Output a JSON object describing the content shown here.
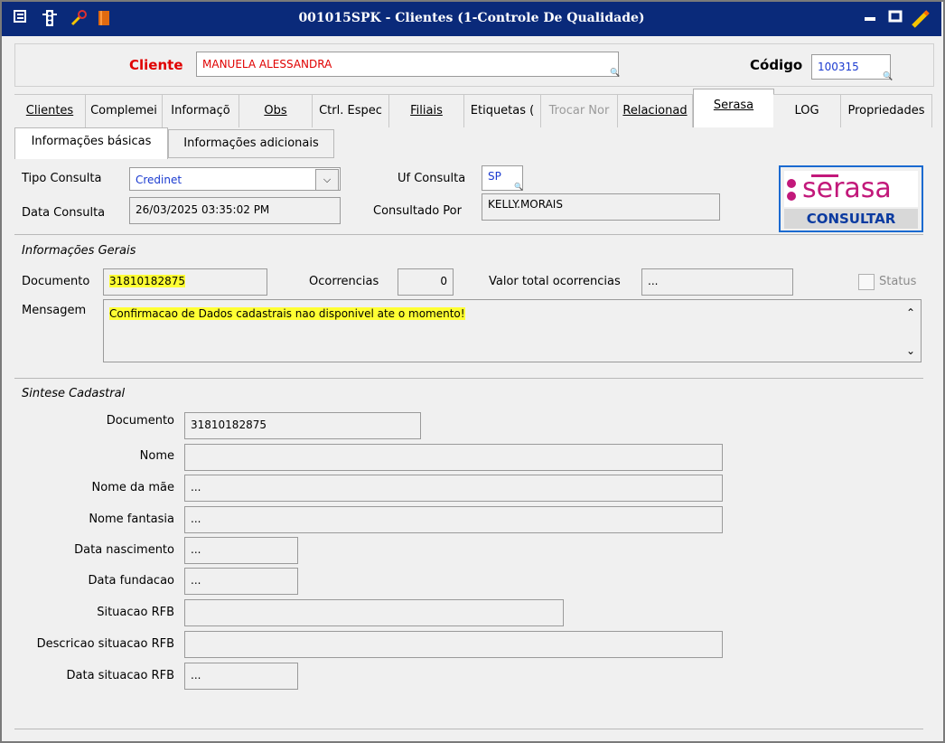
{
  "window": {
    "title": "001015SPK - Clientes (1-Controle De Qualidade)",
    "icons": [
      "menu-icon",
      "traffic-light-icon",
      "wrench-icon",
      "book-icon"
    ],
    "controls": [
      "minimize-icon",
      "maximize-icon",
      "pencil-icon"
    ]
  },
  "header": {
    "cliente_label": "Cliente",
    "cliente_value": "MANUELA ALESSANDRA",
    "codigo_label": "Código",
    "codigo_value": "100315"
  },
  "tabs": [
    {
      "label": "Clientes"
    },
    {
      "label": "Complemei"
    },
    {
      "label": "Informaçõ"
    },
    {
      "label": "Obs"
    },
    {
      "label": "Ctrl. Espec"
    },
    {
      "label": "Filiais"
    },
    {
      "label": "Etiquetas ("
    },
    {
      "label": "Trocar Nor"
    },
    {
      "label": "Relacionad"
    },
    {
      "label": "Serasa"
    },
    {
      "label": "LOG"
    },
    {
      "label": "Propriedades"
    }
  ],
  "subtabs": [
    {
      "label": "Informações básicas"
    },
    {
      "label": "Informações adicionais"
    }
  ],
  "consulta": {
    "tipo_label": "Tipo Consulta",
    "tipo_value": "Credinet",
    "uf_label": "Uf Consulta",
    "uf_value": "SP",
    "data_label": "Data Consulta",
    "data_value": "26/03/2025 03:35:02 PM",
    "consultado_label": "Consultado Por",
    "consultado_value": "KELLY.MORAIS",
    "serasa_logo": "serasa",
    "consultar_label": "CONSULTAR"
  },
  "gerais": {
    "section_label": "Informações Gerais",
    "documento_label": "Documento",
    "documento_value": "31810182875",
    "ocorrencias_label": "Ocorrencias",
    "ocorrencias_value": "0",
    "valor_label": "Valor total ocorrencias",
    "valor_value": "...",
    "status_label": "Status",
    "mensagem_label": "Mensagem",
    "mensagem_value": "Confirmacao de Dados cadastrais nao disponivel ate o momento!"
  },
  "sintese": {
    "section_label": "Sintese Cadastral",
    "rows": [
      {
        "label": "Documento",
        "value": "31810182875"
      },
      {
        "label": "Nome",
        "value": ""
      },
      {
        "label": "Nome da mãe",
        "value": "..."
      },
      {
        "label": "Nome fantasia",
        "value": "..."
      },
      {
        "label": "Data nascimento",
        "value": "..."
      },
      {
        "label": "Data fundacao",
        "value": "..."
      },
      {
        "label": "Situacao RFB",
        "value": ""
      },
      {
        "label": "Descricao situacao RFB",
        "value": ""
      },
      {
        "label": "Data situacao RFB",
        "value": "..."
      }
    ]
  },
  "colors": {
    "titlebar": "#0a2a7a",
    "cliente_red": "#e00000",
    "link_blue": "#1a3ad0",
    "highlight": "#ffff33",
    "serasa_pink": "#c2187a"
  }
}
